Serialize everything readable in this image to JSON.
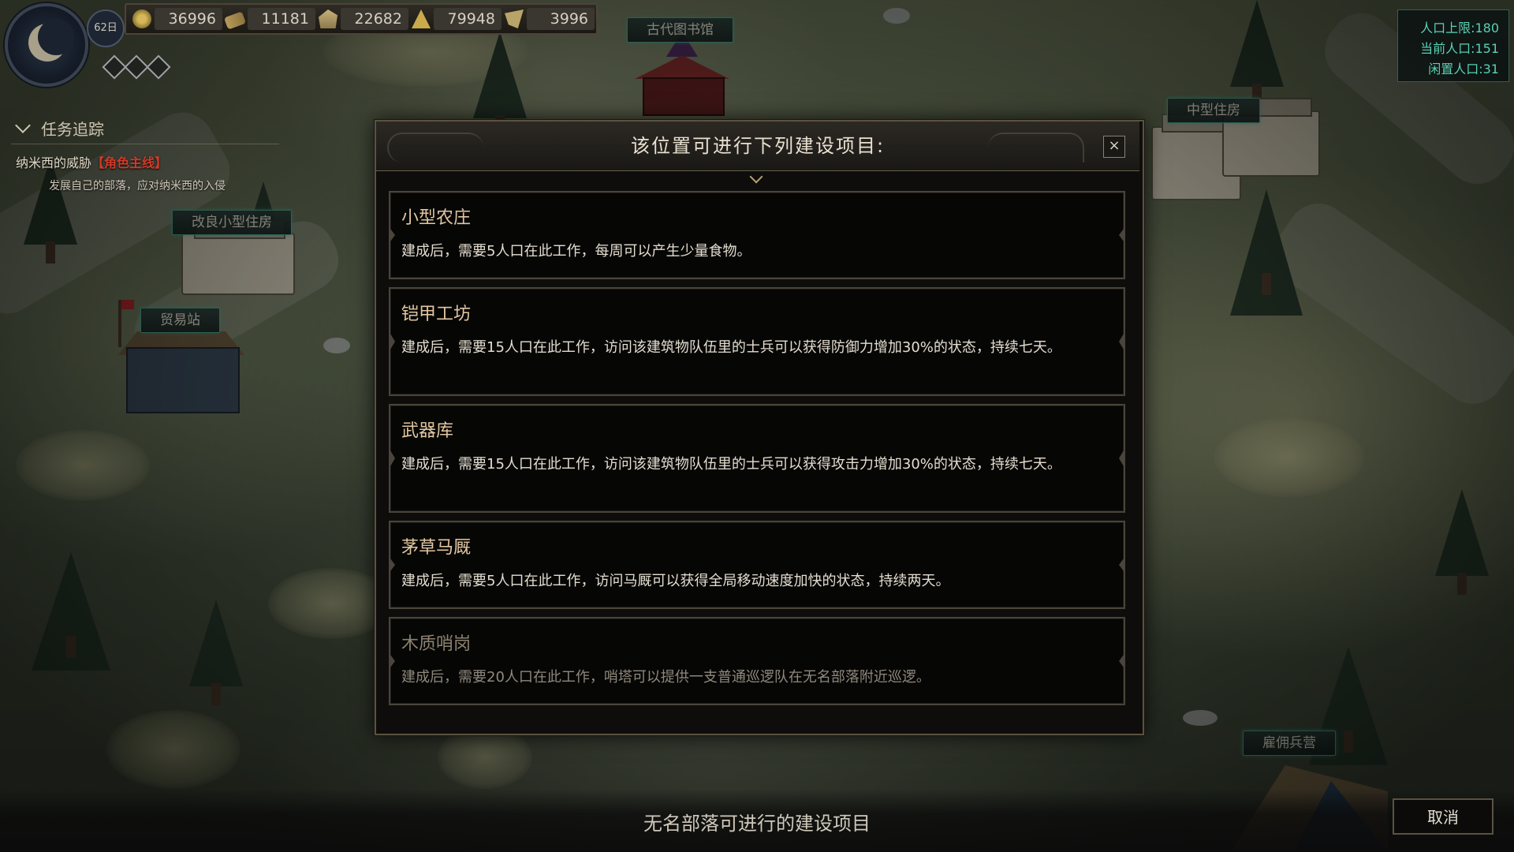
{
  "hud": {
    "day": "62日",
    "resources": [
      {
        "icon": "coin-icon",
        "value": "36996"
      },
      {
        "icon": "wood-icon",
        "value": "11181"
      },
      {
        "icon": "stone-icon",
        "value": "22682"
      },
      {
        "icon": "food-icon",
        "value": "79948"
      },
      {
        "icon": "horn-icon",
        "value": "3996"
      }
    ]
  },
  "quest": {
    "header": "任务追踪",
    "title": "纳米西的威胁",
    "tag": "【角色主线】",
    "desc": "发展自己的部落，应对纳米西的入侵"
  },
  "population": {
    "max": "人口上限:180",
    "current": "当前人口:151",
    "idle": "闲置人口:31"
  },
  "map_labels": {
    "library": "古代图书馆",
    "medium_house": "中型住房",
    "improved_small_house": "改良小型住房",
    "trading_post": "贸易站",
    "mercenary_camp": "雇佣兵营"
  },
  "dialog": {
    "title": "该位置可进行下列建设项目:",
    "close": "×",
    "items": [
      {
        "name": "小型农庄",
        "desc": "建成后，需要5人口在此工作，每周可以产生少量食物。",
        "enabled": true
      },
      {
        "name": "铠甲工坊",
        "desc": "建成后，需要15人口在此工作，访问该建筑物队伍里的士兵可以获得防御力增加30%的状态，持续七天。",
        "enabled": true
      },
      {
        "name": "武器库",
        "desc": "建成后，需要15人口在此工作，访问该建筑物队伍里的士兵可以获得攻击力增加30%的状态，持续七天。",
        "enabled": true
      },
      {
        "name": "茅草马厩",
        "desc": "建成后，需要5人口在此工作，访问马厩可以获得全局移动速度加快的状态，持续两天。",
        "enabled": true
      },
      {
        "name": "木质哨岗",
        "desc": "建成后，需要20人口在此工作，哨塔可以提供一支普通巡逻队在无名部落附近巡逻。",
        "enabled": false
      }
    ]
  },
  "bottom": {
    "caption": "无名部落可进行的建设项目",
    "cancel": "取消"
  },
  "colors": {
    "accent_teal": "#5bd0b4",
    "item_title": "#e2c7a0",
    "quest_tag": "#d23a2a"
  }
}
